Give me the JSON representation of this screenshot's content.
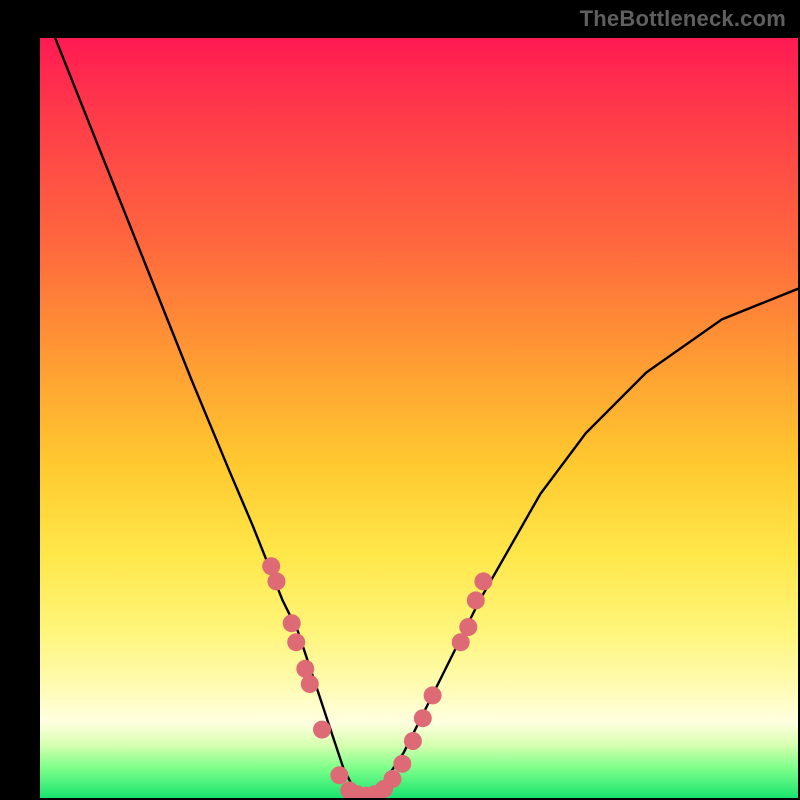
{
  "watermark": {
    "text": "TheBottleneck.com"
  },
  "chart_data": {
    "type": "line",
    "title": "",
    "xlabel": "",
    "ylabel": "",
    "xlim": [
      0,
      100
    ],
    "ylim": [
      0,
      100
    ],
    "series": [
      {
        "name": "curve",
        "x": [
          2,
          8,
          14,
          20,
          25,
          28,
          30,
          32,
          34,
          35,
          36,
          37,
          38,
          39,
          40,
          41,
          42,
          43,
          44,
          45,
          46,
          48,
          50,
          52,
          55,
          58,
          62,
          66,
          72,
          80,
          90,
          100
        ],
        "y": [
          100,
          85,
          70,
          55,
          43,
          36,
          31,
          26,
          22,
          19,
          16,
          13,
          10,
          7,
          4,
          2,
          1,
          0,
          0,
          1,
          3,
          6,
          10,
          14,
          20,
          26,
          33,
          40,
          48,
          56,
          63,
          67
        ]
      }
    ],
    "markers": {
      "name": "dots",
      "color": "#dd6a74",
      "points": [
        {
          "x": 30.5,
          "y": 30.5
        },
        {
          "x": 31.2,
          "y": 28.5
        },
        {
          "x": 33.2,
          "y": 23.0
        },
        {
          "x": 33.8,
          "y": 20.5
        },
        {
          "x": 35.0,
          "y": 17.0
        },
        {
          "x": 35.6,
          "y": 15.0
        },
        {
          "x": 37.2,
          "y": 9.0
        },
        {
          "x": 39.5,
          "y": 3.0
        },
        {
          "x": 40.8,
          "y": 1.0
        },
        {
          "x": 41.8,
          "y": 0.5
        },
        {
          "x": 43.0,
          "y": 0.3
        },
        {
          "x": 44.2,
          "y": 0.5
        },
        {
          "x": 45.4,
          "y": 1.2
        },
        {
          "x": 46.5,
          "y": 2.5
        },
        {
          "x": 47.8,
          "y": 4.5
        },
        {
          "x": 49.2,
          "y": 7.5
        },
        {
          "x": 50.5,
          "y": 10.5
        },
        {
          "x": 51.8,
          "y": 13.5
        },
        {
          "x": 55.5,
          "y": 20.5
        },
        {
          "x": 56.5,
          "y": 22.5
        },
        {
          "x": 57.5,
          "y": 26.0
        },
        {
          "x": 58.5,
          "y": 28.5
        }
      ]
    },
    "gradient_bands": [
      {
        "color": "#ff1a52",
        "from_y": 100,
        "to_y": 88
      },
      {
        "color": "#ff6a3d",
        "from_y": 88,
        "to_y": 58
      },
      {
        "color": "#ffc92f",
        "from_y": 58,
        "to_y": 32
      },
      {
        "color": "#fff57a",
        "from_y": 32,
        "to_y": 15
      },
      {
        "color": "#ffffe0",
        "from_y": 15,
        "to_y": 7
      },
      {
        "color": "#18e56f",
        "from_y": 7,
        "to_y": 0
      }
    ]
  }
}
